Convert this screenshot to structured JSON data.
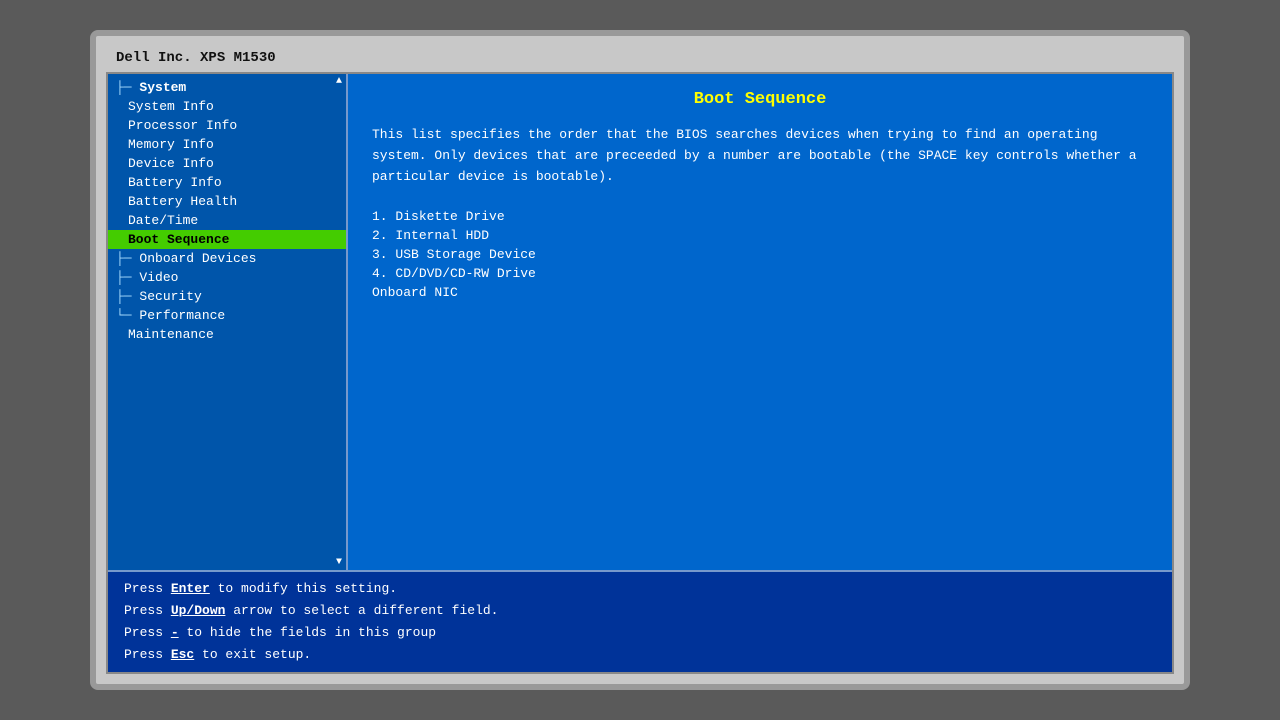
{
  "monitor": {
    "title": "Dell Inc. XPS M1530"
  },
  "sidebar": {
    "items": [
      {
        "id": "system",
        "label": "System",
        "type": "group",
        "indent": 0,
        "prefix": "├─"
      },
      {
        "id": "system-info",
        "label": "System Info",
        "type": "child",
        "indent": 1
      },
      {
        "id": "processor-info",
        "label": "Processor Info",
        "type": "child",
        "indent": 1
      },
      {
        "id": "memory-info",
        "label": "Memory Info",
        "type": "child",
        "indent": 1
      },
      {
        "id": "device-info",
        "label": "Device Info",
        "type": "child",
        "indent": 1
      },
      {
        "id": "battery-info",
        "label": "Battery Info",
        "type": "child",
        "indent": 1
      },
      {
        "id": "battery-health",
        "label": "Battery Health",
        "type": "child",
        "indent": 1
      },
      {
        "id": "datetime",
        "label": "Date/Time",
        "type": "child",
        "indent": 1
      },
      {
        "id": "boot-sequence",
        "label": "Boot Sequence",
        "type": "child",
        "indent": 1,
        "selected": true
      },
      {
        "id": "onboard-devices",
        "label": "Onboard Devices",
        "type": "child",
        "indent": 0,
        "prefix": "├─"
      },
      {
        "id": "video",
        "label": "Video",
        "type": "child",
        "indent": 0,
        "prefix": "├─"
      },
      {
        "id": "security",
        "label": "Security",
        "type": "child",
        "indent": 0,
        "prefix": "├─"
      },
      {
        "id": "performance",
        "label": "Performance",
        "type": "child",
        "indent": 0,
        "prefix": "└─"
      },
      {
        "id": "maintenance",
        "label": "Maintenance",
        "type": "child",
        "indent": 1
      }
    ]
  },
  "content": {
    "title": "Boot Sequence",
    "description": "This list specifies the order that the BIOS searches devices when trying to find an operating system. Only devices that are preceeded by a number are bootable (the SPACE key controls whether a particular device is bootable).",
    "boot_items": [
      {
        "number": "1.",
        "label": "Diskette Drive"
      },
      {
        "number": "2.",
        "label": "Internal HDD"
      },
      {
        "number": "3.",
        "label": "USB Storage Device"
      },
      {
        "number": "4.",
        "label": "CD/DVD/CD-RW Drive"
      },
      {
        "number": " ",
        "label": "Onboard NIC"
      }
    ]
  },
  "status_bar": {
    "lines": [
      {
        "parts": [
          {
            "type": "normal",
            "text": "Press "
          },
          {
            "type": "key",
            "text": "Enter"
          },
          {
            "type": "normal",
            "text": " to modify this setting."
          }
        ]
      },
      {
        "parts": [
          {
            "type": "normal",
            "text": "Press "
          },
          {
            "type": "key",
            "text": "Up/Down"
          },
          {
            "type": "normal",
            "text": " arrow to select a different field."
          }
        ]
      },
      {
        "parts": [
          {
            "type": "normal",
            "text": "Press "
          },
          {
            "type": "key",
            "text": "-"
          },
          {
            "type": "normal",
            "text": " to hide the fields in this group"
          }
        ]
      },
      {
        "parts": [
          {
            "type": "normal",
            "text": "Press "
          },
          {
            "type": "key",
            "text": "Esc"
          },
          {
            "type": "normal",
            "text": " to exit setup."
          }
        ]
      }
    ]
  },
  "colors": {
    "bios_bg": "#0055aa",
    "right_bg": "#0066cc",
    "selected_bg": "#44cc00",
    "title_color": "#ffff00",
    "text_color": "#ffffff"
  }
}
